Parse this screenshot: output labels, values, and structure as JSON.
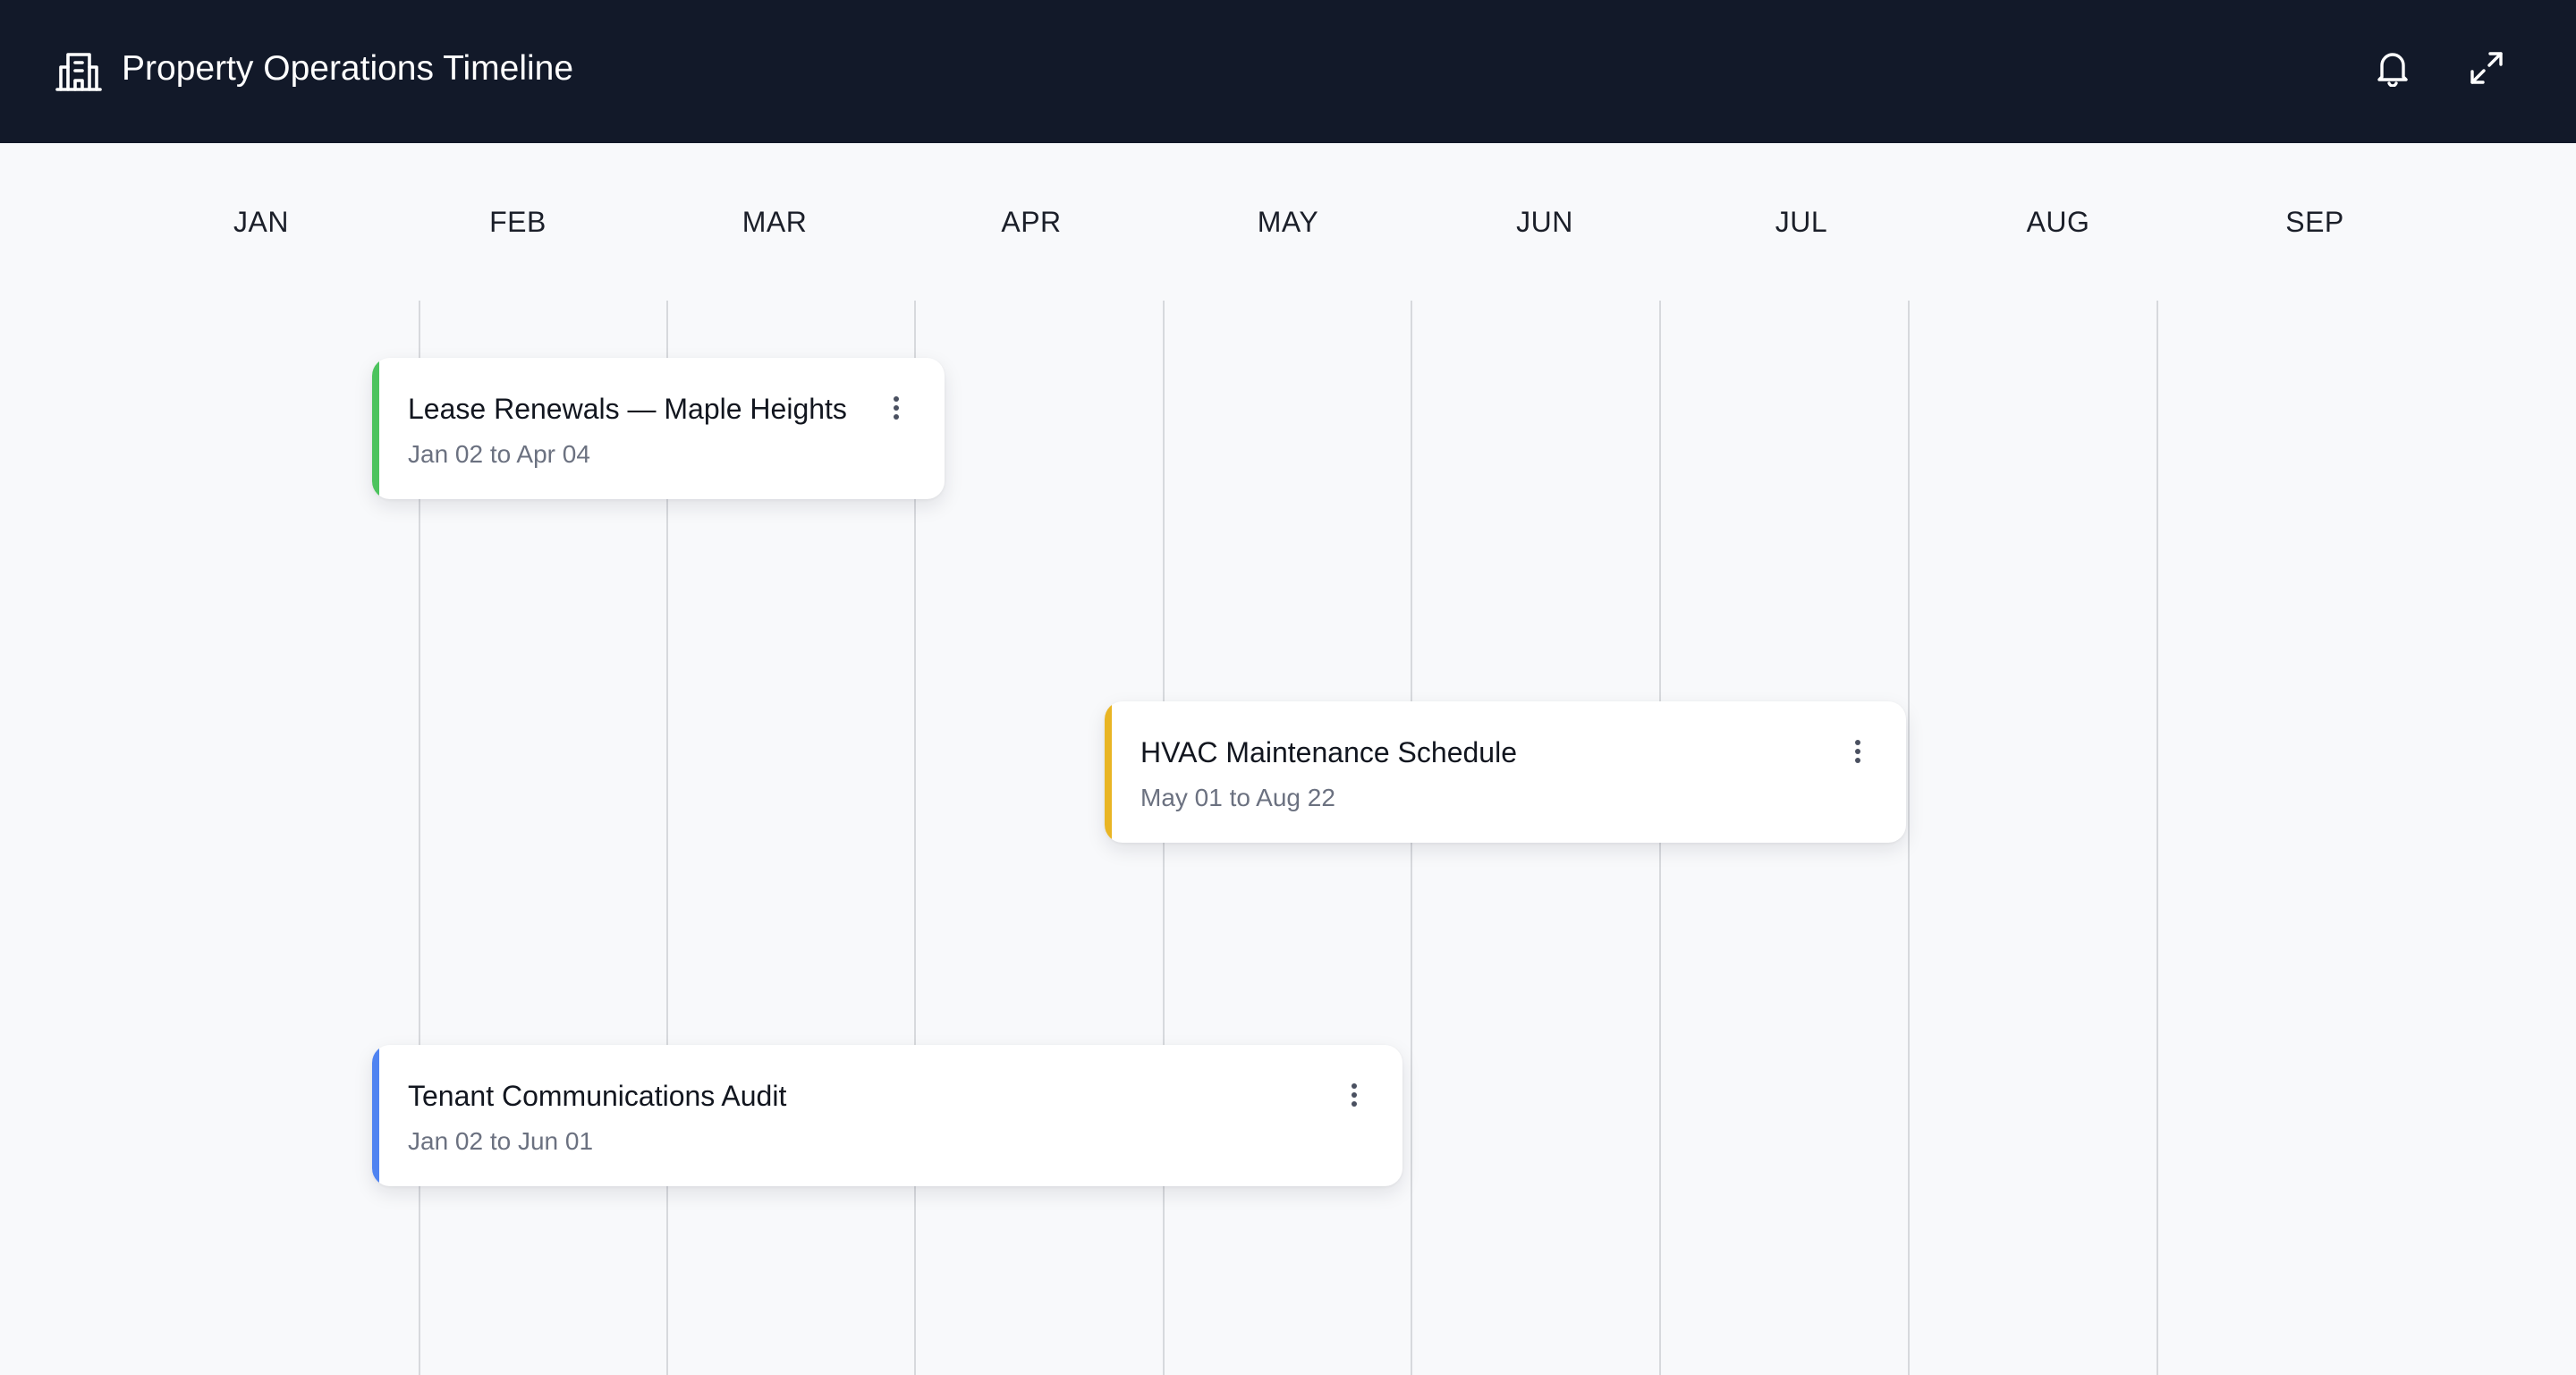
{
  "header": {
    "title": "Property Operations Timeline",
    "brand_icon": "building-icon",
    "actions": [
      {
        "name": "notifications",
        "icon": "bell-icon"
      },
      {
        "name": "fullscreen",
        "icon": "expand-icon"
      }
    ],
    "background": "#121929"
  },
  "timeline": {
    "months": [
      "JAN",
      "FEB",
      "MAR",
      "APR",
      "MAY",
      "JUN",
      "JUL",
      "AUG",
      "SEP"
    ],
    "tasks": [
      {
        "title": "Lease Renewals — Maple Heights",
        "dates": "Jan 02 to Apr 04",
        "accent": "#4cc35e"
      },
      {
        "title": "HVAC Maintenance Schedule",
        "dates": "May 01 to Aug 22",
        "accent": "#e9b524"
      },
      {
        "title": "Tenant Communications Audit",
        "dates": "Jan 02 to Jun 01",
        "accent": "#4f83f1"
      }
    ]
  }
}
